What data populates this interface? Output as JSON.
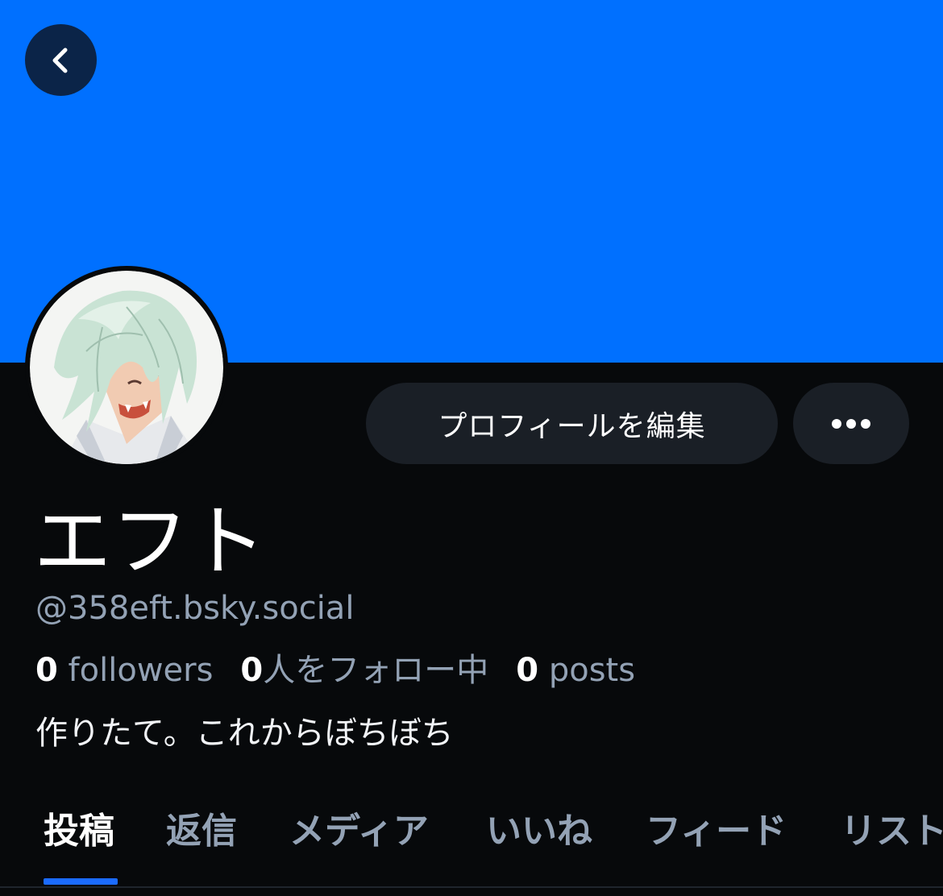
{
  "colors": {
    "banner": "#0070ff",
    "background": "#07090b",
    "button_bg": "#1a1f26",
    "muted_text": "#93a2b5",
    "tab_indicator": "#1b6bff"
  },
  "header": {
    "back_icon": "chevron-left-icon"
  },
  "actions": {
    "edit_profile_label": "プロフィールを編集",
    "more_icon": "ellipsis-icon"
  },
  "profile": {
    "display_name": "エフト",
    "handle": "@358eft.bsky.social",
    "bio": "作りたて。これからぼちぼち",
    "avatar_icon": "avatar-illustration"
  },
  "stats": {
    "followers_count": "0",
    "followers_label": " followers",
    "following_count": "0",
    "following_label": "人をフォロー中",
    "posts_count": "0",
    "posts_label": " posts"
  },
  "tabs": [
    {
      "label": "投稿",
      "active": true
    },
    {
      "label": "返信"
    },
    {
      "label": "メディア"
    },
    {
      "label": "いいね"
    },
    {
      "label": "フィード"
    },
    {
      "label": "リスト"
    }
  ]
}
